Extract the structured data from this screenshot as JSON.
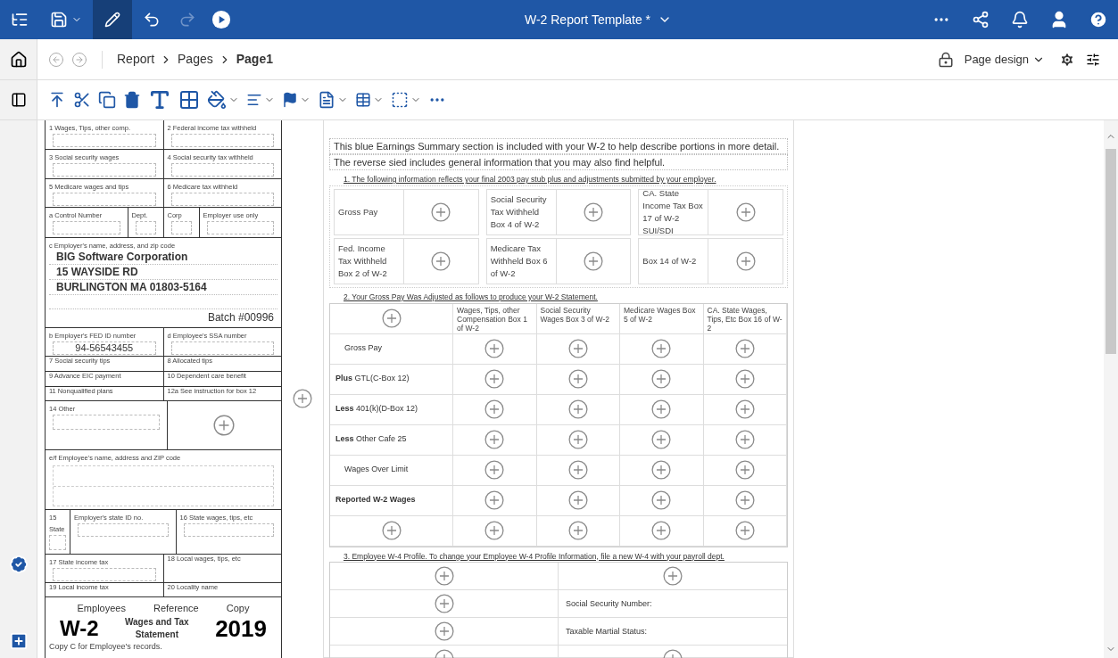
{
  "app_bar": {
    "title": "W-2 Report Template *"
  },
  "breadcrumb": [
    {
      "label": "Report",
      "current": false
    },
    {
      "label": "Pages",
      "current": false
    },
    {
      "label": "Page1",
      "current": true
    }
  ],
  "view_menu": {
    "label": "Page design"
  },
  "w2_form": {
    "bands": [
      {
        "cells": [
          {
            "kind": "field",
            "label": "1 Wages, Tips, other comp."
          },
          {
            "kind": "field",
            "label": "2 Federal income tax withheld"
          }
        ]
      },
      {
        "cells": [
          {
            "kind": "field",
            "label": "3 Social security wages"
          },
          {
            "kind": "field",
            "label": "4 Social security tax withheld"
          }
        ]
      },
      {
        "cells": [
          {
            "kind": "field",
            "label": "5 Medicare wages and tips"
          },
          {
            "kind": "field",
            "label": "6 Medicare tax withheld"
          }
        ]
      },
      {
        "cells": [
          {
            "kind": "field",
            "label": "a Control Number"
          },
          {
            "kind": "field_narrow",
            "label": "Dept."
          },
          {
            "kind": "field_narrow",
            "label": "Corp"
          },
          {
            "kind": "field",
            "label": "Employer use only"
          }
        ]
      },
      {
        "cells": [
          {
            "kind": "address",
            "label": "c Employer's name, address, and zip code",
            "lines": [
              "BIG Software Corporation",
              "15 WAYSIDE RD",
              "BURLINGTON MA 01803-5164"
            ],
            "note": "Batch #00996"
          }
        ]
      },
      {
        "cells": [
          {
            "kind": "field",
            "label": "b Employer's FED ID number",
            "value": "94-56543455"
          },
          {
            "kind": "field",
            "label": "d Employee's SSA number"
          }
        ]
      },
      {
        "cells": [
          {
            "kind": "label",
            "label": "7 Social security tips"
          },
          {
            "kind": "label",
            "label": "8 Allocated tips"
          }
        ]
      },
      {
        "cells": [
          {
            "kind": "label",
            "label": "9 Advance EIC payment"
          },
          {
            "kind": "label",
            "label": "10 Dependent care benefit"
          }
        ]
      },
      {
        "cells": [
          {
            "kind": "label",
            "label": "11 Nonqualified plans"
          },
          {
            "kind": "label",
            "label": "12a See instruction for box 12"
          }
        ]
      },
      {
        "cells": [
          {
            "kind": "field_tall",
            "label": "14 Other"
          },
          {
            "kind": "plus"
          }
        ]
      },
      {
        "cells": [
          {
            "kind": "address",
            "label": "e/f Employee's name, address and ZIP code"
          }
        ]
      },
      {
        "cells": [
          {
            "kind": "state",
            "label": "15",
            "sublabel": "State"
          },
          {
            "kind": "field",
            "label": "Employer's state ID no."
          },
          {
            "kind": "field",
            "label": "16 State wages, tips, etc"
          }
        ]
      },
      {
        "cells": [
          {
            "kind": "field",
            "label": "17 State income tax"
          },
          {
            "kind": "label",
            "label": "18 Local wages, tips, etc"
          }
        ]
      },
      {
        "cells": [
          {
            "kind": "label",
            "label": "19 Local income tax"
          },
          {
            "kind": "label",
            "label": "20 Locality name"
          }
        ]
      }
    ],
    "footer": {
      "copy_labels": [
        "Employees",
        "Reference",
        "Copy"
      ],
      "form": "W-2",
      "title": "Wages and Tax Statement",
      "year": "2019",
      "note": "Copy C for Employee's records."
    }
  },
  "summary": {
    "intro": [
      "This blue Earnings Summary section is included with your W-2 to help describe portions in more detail.",
      "The reverse sied includes general information that you may also find helpful."
    ],
    "section_1": {
      "heading": "1. The following information reflects your final 2003 pay stub plus and adjustments submitted by your employer.",
      "tiles": [
        {
          "label": "Gross Pay"
        },
        {
          "label": "Social Security Tax Withheld Box 4 of W-2"
        },
        {
          "label": "CA. State Income Tax Box 17 of W-2 SUI/SDI"
        },
        {
          "label": "Fed. Income Tax Withheld Box 2 of W-2"
        },
        {
          "label": "Medicare Tax Withheld Box 6 of W-2"
        },
        {
          "label": "Box 14 of W-2"
        }
      ]
    },
    "section_2": {
      "heading": "2. Your Gross Pay Was Adjusted as follows to produce your W-2 Statement.",
      "columns": [
        "Wages, Tips, other Compensation Box 1 of W-2",
        "Social Security Wages Box 3 of W-2",
        "Medicare Wages Box 5 of W-2",
        "CA. State Wages, Tips, Etc Box 16 of W-2"
      ],
      "rows": [
        {
          "kind": "indented",
          "label": "Gross Pay"
        },
        {
          "kind": "adjustment",
          "label": "**Plus** GTL(C-Box 12)"
        },
        {
          "kind": "adjustment",
          "label": "**Less** 401(k)(D-Box 12)"
        },
        {
          "kind": "adjustment",
          "label": "**Less** Other Cafe 25"
        },
        {
          "kind": "indented",
          "label": "Wages Over Limit"
        },
        {
          "kind": "total",
          "label": "Reported W-2 Wages"
        },
        {
          "kind": "blank"
        }
      ]
    },
    "section_3": {
      "heading": "3. Employee W-4 Profile. To change your Employee W-4 Profile Information, file a new W-4 with your payroll dept.",
      "rows": [
        {},
        {
          "label": "Social Security Number:"
        },
        {
          "label": "Taxable Martial Status:"
        },
        {}
      ]
    }
  }
}
